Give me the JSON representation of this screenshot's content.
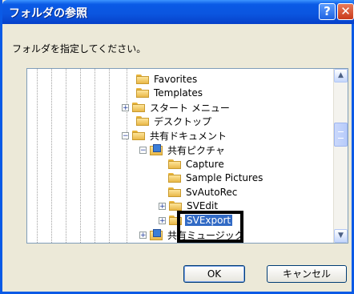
{
  "dialog": {
    "title": "フォルダの参照",
    "help_label": "?",
    "close_label": "✕",
    "instruction": "フォルダを指定してください。"
  },
  "tree": {
    "items": [
      {
        "label": "Favorites",
        "expander": "",
        "icon": "folder-icon"
      },
      {
        "label": "Templates",
        "expander": "",
        "icon": "folder-icon"
      },
      {
        "label": "スタート メニュー",
        "expander": "+",
        "icon": "folder-icon"
      },
      {
        "label": "デスクトップ",
        "expander": "",
        "icon": "folder-icon"
      },
      {
        "label": "共有ドキュメント",
        "expander": "−",
        "icon": "folder-icon"
      },
      {
        "label": "共有ピクチャ",
        "expander": "−",
        "icon": "shared-pictures-icon"
      },
      {
        "label": "Capture",
        "expander": "",
        "icon": "folder-icon"
      },
      {
        "label": "Sample Pictures",
        "expander": "",
        "icon": "folder-icon"
      },
      {
        "label": "SvAutoRec",
        "expander": "",
        "icon": "folder-icon"
      },
      {
        "label": "SVEdit",
        "expander": "+",
        "icon": "folder-icon"
      },
      {
        "label": "SVExport",
        "expander": "+",
        "icon": "folder-icon",
        "selected": true
      },
      {
        "label": "共有ミュージック",
        "expander": "+",
        "icon": "shared-music-icon"
      }
    ]
  },
  "buttons": {
    "ok_label": "OK",
    "cancel_label": "キャンセル"
  },
  "scrollbar": {
    "up_glyph": "▲",
    "down_glyph": "▼"
  },
  "colors": {
    "title_blue": "#0a5ae6",
    "dialog_bg": "#ece9d8",
    "selection": "#316ac5"
  }
}
